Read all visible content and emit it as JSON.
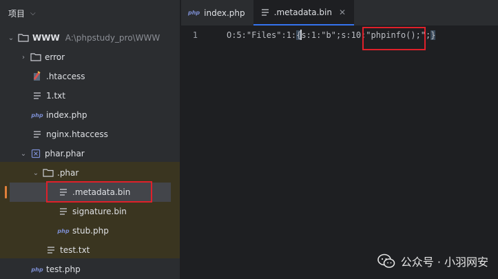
{
  "sidebar": {
    "header": "项目",
    "items": [
      {
        "label": "WWW",
        "sub": "A:\\phpstudy_pro\\WWW",
        "icon": "folder-icon",
        "arrow": "open"
      },
      {
        "label": "error",
        "icon": "folder-icon",
        "arrow": "closed"
      },
      {
        "label": ".htaccess",
        "icon": "htaccess-file-icon"
      },
      {
        "label": "1.txt",
        "icon": "text-file-icon"
      },
      {
        "label": "index.php",
        "icon": "php-file-icon"
      },
      {
        "label": "nginx.htaccess",
        "icon": "text-file-icon"
      },
      {
        "label": "phar.phar",
        "icon": "archive-file-icon",
        "arrow": "open"
      },
      {
        "label": ".phar",
        "icon": "folder-icon",
        "arrow": "open"
      },
      {
        "label": ".metadata.bin",
        "icon": "text-file-icon"
      },
      {
        "label": "signature.bin",
        "icon": "text-file-icon"
      },
      {
        "label": "stub.php",
        "icon": "php-file-icon"
      },
      {
        "label": "test.txt",
        "icon": "text-file-icon"
      },
      {
        "label": "test.php",
        "icon": "php-file-icon"
      }
    ]
  },
  "tabs": [
    {
      "label": "index.php",
      "icon": "php-file-icon",
      "active": false
    },
    {
      "label": ".metadata.bin",
      "icon": "text-file-icon",
      "active": true,
      "close": "✕"
    }
  ],
  "editor": {
    "line_number": "1",
    "code_before": "O:5:\"Files\":1:",
    "code_brace_open": "{",
    "code_middle": "s:1:\"b\";s:10:\"",
    "code_highlight": "phpinfo();",
    "code_after": "\";",
    "code_brace_close": "}"
  },
  "php_badge": "php",
  "watermark": "公众号 · 小羽网安",
  "colors": {
    "accent": "#3574f0",
    "annotation_red": "#e0202a",
    "scope_bg": "#3a3520"
  }
}
